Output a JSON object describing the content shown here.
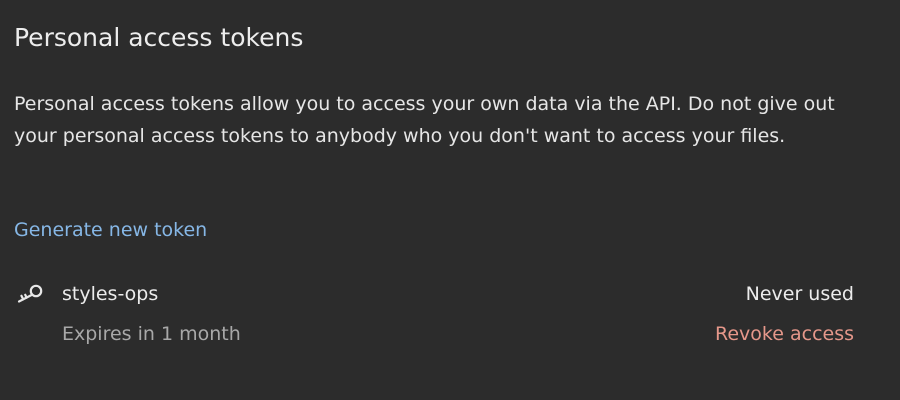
{
  "section": {
    "title": "Personal access tokens",
    "description": "Personal access tokens allow you to access your own data via the API. Do not give out your personal access tokens to anybody who you don't want to access your files.",
    "generate_label": "Generate new token"
  },
  "tokens": [
    {
      "icon": "key-icon",
      "name": "styles-ops",
      "expiry": "Expires in 1 month",
      "usage": "Never used",
      "revoke_label": "Revoke access"
    }
  ],
  "colors": {
    "background": "#2c2c2c",
    "link": "#86b7e6",
    "danger": "#e5978a",
    "muted_text": "#a8a8a8"
  }
}
